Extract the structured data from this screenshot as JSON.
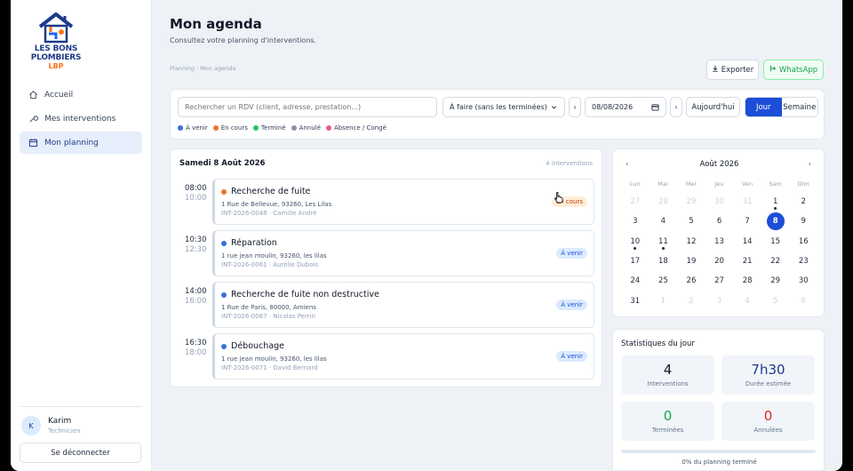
{
  "brand": {
    "line1": "LES BONS",
    "line2": "PLOMBIERS",
    "line3": "LBP"
  },
  "nav": [
    {
      "label": "Accueil",
      "icon": "home-icon",
      "active": false
    },
    {
      "label": "Mes interventions",
      "icon": "wrench-icon",
      "active": false
    },
    {
      "label": "Mon planning",
      "icon": "calendar-icon",
      "active": true
    }
  ],
  "user": {
    "initial": "K",
    "name": "Karim",
    "role": "Technicien",
    "logout": "Se déconnecter"
  },
  "header": {
    "title": "Mon agenda",
    "subtitle": "Consultez votre planning d'interventions.",
    "breadcrumb": "Planning · Mon agenda",
    "export_label": "Exporter",
    "whatsapp_label": "WhatsApp"
  },
  "filters": {
    "search_placeholder": "Rechercher un RDV (client, adresse, prestation...)",
    "status_select": "À faire (sans les terminées)",
    "prev": "‹",
    "next": "›",
    "date": "08/08/2026",
    "today_label": "Aujourd'hui",
    "view_day": "Jour",
    "view_week": "Semaine",
    "legend": [
      {
        "label": "À venir",
        "color": "#3b6fd8"
      },
      {
        "label": "En cours",
        "color": "#f0712c"
      },
      {
        "label": "Terminé",
        "color": "#22c55e"
      },
      {
        "label": "Annulé",
        "color": "#8a94a3"
      },
      {
        "label": "Absence / Congé",
        "color": "#ec5b8a"
      }
    ]
  },
  "agenda": {
    "date_label": "Samedi 8 Août 2026",
    "count_label": "4 interventions",
    "items": [
      {
        "start": "08:00",
        "end": "10:00",
        "title": "Recherche de fuite",
        "address": "1 Rue de Bellevue, 93260, Les Lilas",
        "ref": "INT-2026-0048 · Camille André",
        "status": "En cours",
        "status_color": "#f0712c",
        "badge_type": "orange"
      },
      {
        "start": "10:30",
        "end": "12:30",
        "title": "Réparation",
        "address": "1 rue jean moulin, 93260, les lilas",
        "ref": "INT-2026-0061 · Aurélie Dubois",
        "status": "À venir",
        "status_color": "#3b6fd8",
        "badge_type": "blue"
      },
      {
        "start": "14:00",
        "end": "16:00",
        "title": "Recherche de fuite non destructive",
        "address": "1 Rue de Paris, 80000, Amiens",
        "ref": "INT-2026-0067 · Nicolas Perrin",
        "status": "À venir",
        "status_color": "#3b6fd8",
        "badge_type": "blue"
      },
      {
        "start": "16:30",
        "end": "18:00",
        "title": "Débouchage",
        "address": "1 rue jean moulin, 93260, les lilas",
        "ref": "INT-2026-0071 · David Bernard",
        "status": "À venir",
        "status_color": "#3b6fd8",
        "badge_type": "blue"
      }
    ]
  },
  "calendar": {
    "month_label": "Août 2026",
    "prev": "‹",
    "next": "›",
    "weekdays": [
      "Lun",
      "Mar",
      "Mer",
      "Jeu",
      "Ven",
      "Sam",
      "Dim"
    ],
    "weeks": [
      [
        {
          "d": "27",
          "m": true
        },
        {
          "d": "28",
          "m": true
        },
        {
          "d": "29",
          "m": true
        },
        {
          "d": "30",
          "m": true
        },
        {
          "d": "31",
          "m": true
        },
        {
          "d": "1",
          "mark": true
        },
        {
          "d": "2"
        }
      ],
      [
        {
          "d": "3"
        },
        {
          "d": "4"
        },
        {
          "d": "5"
        },
        {
          "d": "6"
        },
        {
          "d": "7"
        },
        {
          "d": "8",
          "selected": true
        },
        {
          "d": "9"
        }
      ],
      [
        {
          "d": "10",
          "mark": true
        },
        {
          "d": "11",
          "mark": true
        },
        {
          "d": "12"
        },
        {
          "d": "13"
        },
        {
          "d": "14"
        },
        {
          "d": "15"
        },
        {
          "d": "16"
        }
      ],
      [
        {
          "d": "17"
        },
        {
          "d": "18"
        },
        {
          "d": "19"
        },
        {
          "d": "20"
        },
        {
          "d": "21"
        },
        {
          "d": "22"
        },
        {
          "d": "23"
        }
      ],
      [
        {
          "d": "24"
        },
        {
          "d": "25"
        },
        {
          "d": "26"
        },
        {
          "d": "27"
        },
        {
          "d": "28"
        },
        {
          "d": "29"
        },
        {
          "d": "30"
        }
      ],
      [
        {
          "d": "31"
        },
        {
          "d": "1",
          "m": true
        },
        {
          "d": "2",
          "m": true
        },
        {
          "d": "3",
          "m": true
        },
        {
          "d": "4",
          "m": true
        },
        {
          "d": "5",
          "m": true
        },
        {
          "d": "6",
          "m": true
        }
      ]
    ]
  },
  "stats": {
    "title": "Statistiques du jour",
    "cards": [
      {
        "value": "4",
        "label": "Interventions",
        "color": "#111827"
      },
      {
        "value": "7h30",
        "label": "Durée estimée",
        "color": "#1e3a8a"
      },
      {
        "value": "0",
        "label": "Terminées",
        "color": "#16a34a"
      },
      {
        "value": "0",
        "label": "Annulées",
        "color": "#dc2626"
      }
    ],
    "progress": 0,
    "progress_label": "0% du planning terminé"
  }
}
